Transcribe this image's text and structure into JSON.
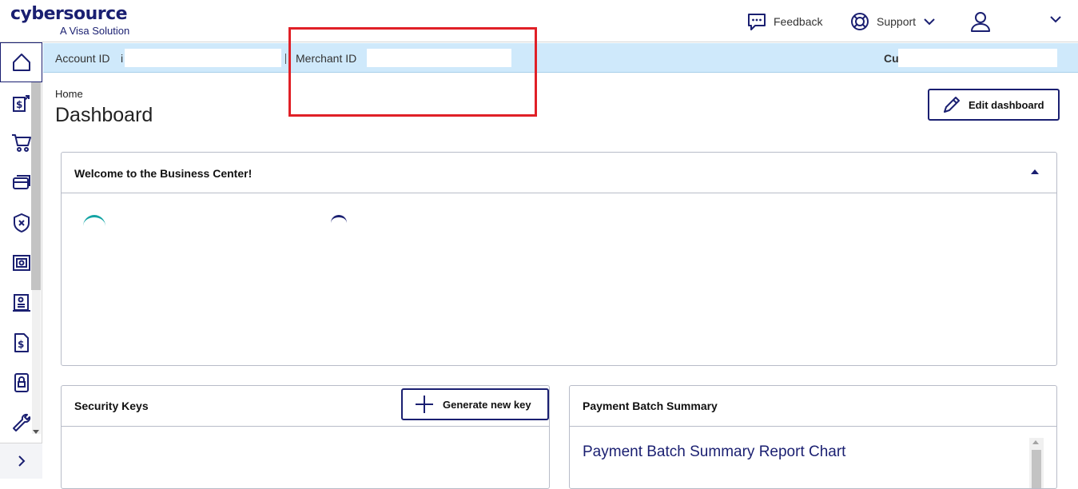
{
  "brand": {
    "name": "cybersource",
    "tagline": "A Visa Solution"
  },
  "header": {
    "feedback_label": "Feedback",
    "support_label": "Support"
  },
  "sidebar": {
    "items": [
      {
        "icon": "home-icon"
      },
      {
        "icon": "transactions-icon"
      },
      {
        "icon": "shopping-cart-icon"
      },
      {
        "icon": "payment-card-icon"
      },
      {
        "icon": "shield-icon"
      },
      {
        "icon": "vault-icon"
      },
      {
        "icon": "reports-icon"
      },
      {
        "icon": "invoice-icon"
      },
      {
        "icon": "device-lock-icon"
      },
      {
        "icon": "wrench-icon"
      }
    ]
  },
  "infobar": {
    "account_label": "Account ID",
    "account_prefix": "i",
    "merchant_label": "Merchant ID",
    "customer_label": "Cu"
  },
  "page": {
    "breadcrumb": "Home",
    "title": "Dashboard",
    "edit_label": "Edit dashboard"
  },
  "welcome_card": {
    "title": "Welcome to the Business Center!"
  },
  "security_card": {
    "title": "Security Keys",
    "generate_label": "Generate new key"
  },
  "payment_card": {
    "title": "Payment Batch Summary",
    "chart_title": "Payment Batch Summary Report Chart"
  },
  "colors": {
    "brand": "#1a1f71",
    "infobar": "#cfe9fb",
    "highlight": "#e02027"
  }
}
